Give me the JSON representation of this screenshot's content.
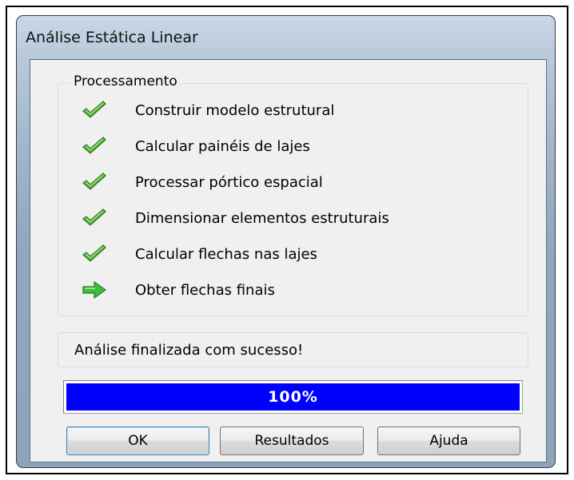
{
  "window": {
    "title": "Análise Estática Linear"
  },
  "processing": {
    "legend": "Processamento",
    "steps": [
      {
        "label": "Construir modelo estrutural",
        "icon": "check-icon",
        "state": "done"
      },
      {
        "label": "Calcular painéis de lajes",
        "icon": "check-icon",
        "state": "done"
      },
      {
        "label": "Processar pórtico espacial",
        "icon": "check-icon",
        "state": "done"
      },
      {
        "label": "Dimensionar elementos estruturais",
        "icon": "check-icon",
        "state": "done"
      },
      {
        "label": "Calcular flechas nas lajes",
        "icon": "check-icon",
        "state": "done"
      },
      {
        "label": "Obter flechas finais",
        "icon": "arrow-right-icon",
        "state": "current"
      }
    ]
  },
  "status": {
    "message": "Análise finalizada com sucesso!"
  },
  "progress": {
    "percent": 100,
    "label": "100%",
    "color": "#0000ff"
  },
  "buttons": {
    "ok": "OK",
    "results": "Resultados",
    "help": "Ajuda"
  },
  "colors": {
    "check": "#4caf32",
    "arrow": "#3cbf3a"
  }
}
